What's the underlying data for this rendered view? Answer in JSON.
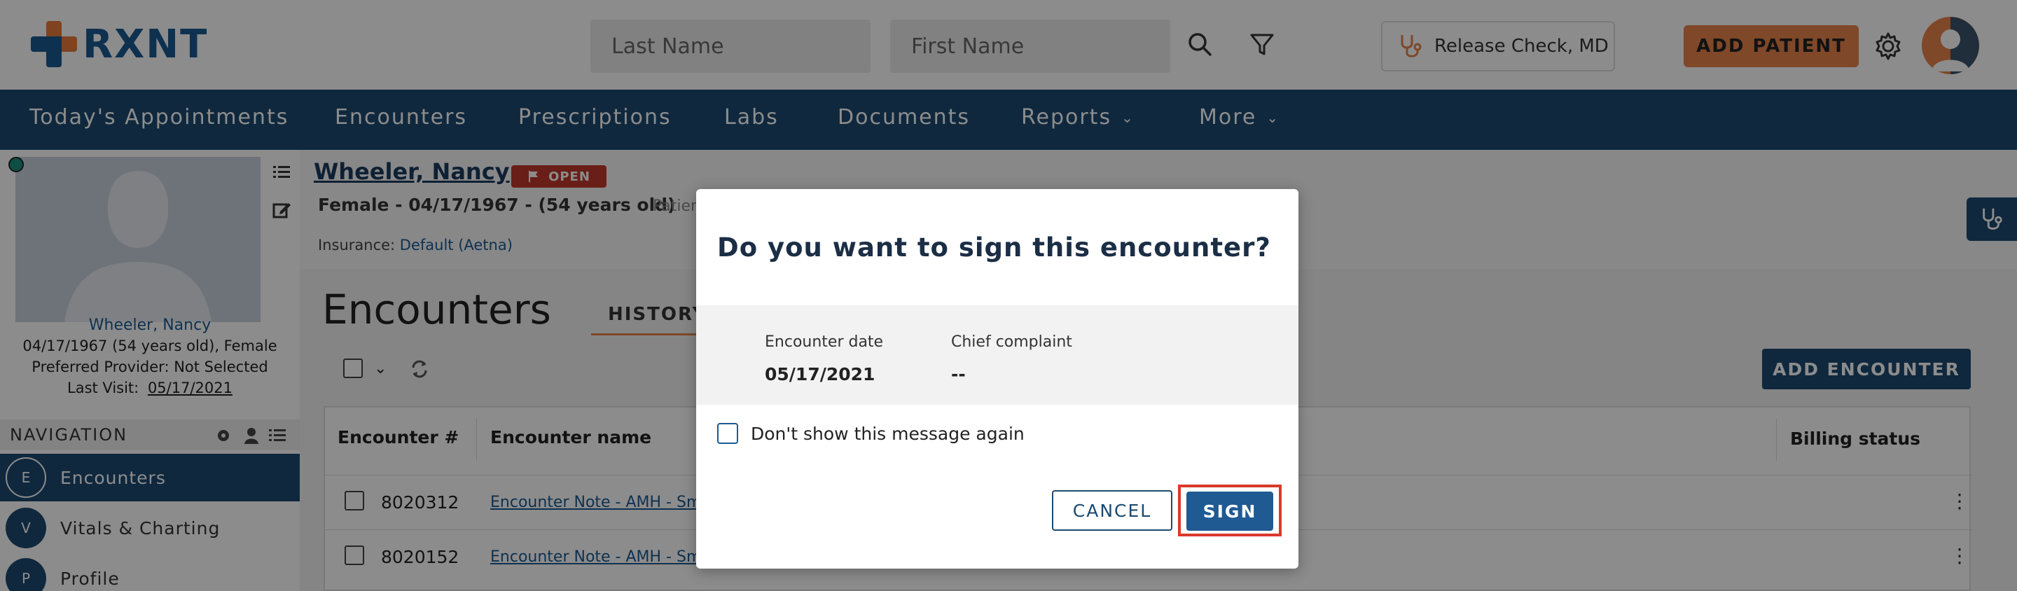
{
  "header": {
    "logo_text": "RXNT",
    "last_name_placeholder": "Last Name",
    "first_name_placeholder": "First Name",
    "provider": "Release Check, MD",
    "add_patient": "ADD PATIENT"
  },
  "nav": {
    "items": [
      {
        "label": "Today's Appointments"
      },
      {
        "label": "Encounters"
      },
      {
        "label": "Prescriptions"
      },
      {
        "label": "Labs"
      },
      {
        "label": "Documents"
      },
      {
        "label": "Reports"
      },
      {
        "label": "More"
      }
    ]
  },
  "patient": {
    "name": "Wheeler, Nancy",
    "header_name": "Wheeler, Nancy",
    "dob_line": "04/17/1967 (54 years old), Female",
    "provider_line": "Preferred Provider: Not Selected",
    "last_visit_label": "Last Visit:",
    "last_visit": "05/17/2021",
    "status": "OPEN",
    "demographics": "Female - 04/17/1967 - (54 years old)",
    "demographics_extra": "Patien",
    "insurance_label": "Insurance:",
    "insurance": "Default (Aetna)"
  },
  "sidebar": {
    "navigation_label": "NAVIGATION",
    "items": [
      {
        "letter": "E",
        "label": "Encounters"
      },
      {
        "letter": "V",
        "label": "Vitals & Charting"
      },
      {
        "letter": "P",
        "label": "Profile"
      }
    ]
  },
  "main": {
    "title": "Encounters",
    "history_tab": "HISTORY",
    "add_encounter": "ADD ENCOUNTER",
    "columns": {
      "num": "Encounter #",
      "name": "Encounter name",
      "billing": "Billing status"
    },
    "rows": [
      {
        "num": "8020312",
        "name": "Encounter Note - AMH - Sm"
      },
      {
        "num": "8020152",
        "name": "Encounter Note - AMH - Sm"
      }
    ]
  },
  "modal": {
    "title": "Do you want to sign this encounter?",
    "date_label": "Encounter date",
    "date_value": "05/17/2021",
    "complaint_label": "Chief complaint",
    "complaint_value": "--",
    "dont_show": "Don't show this message again",
    "cancel": "CANCEL",
    "sign": "SIGN"
  }
}
